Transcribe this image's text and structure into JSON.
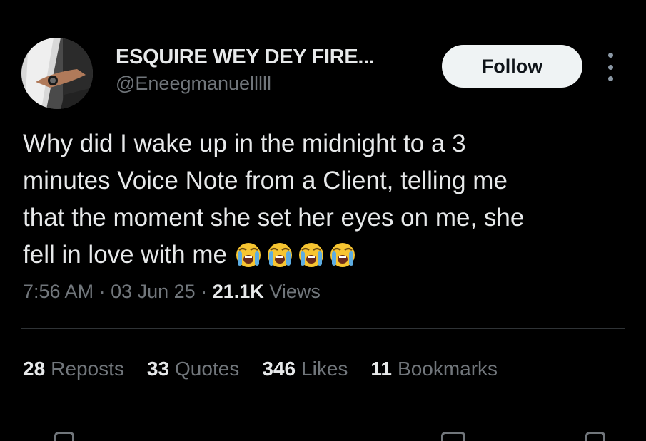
{
  "author": {
    "display_name": "ESQUIRE WEY DEY FIRE...",
    "handle": "@Eneegmanuelllll"
  },
  "follow_button": {
    "label": "Follow"
  },
  "tweet": {
    "text_lines": [
      "Why did I wake up in the midnight to a 3",
      "minutes Voice Note from a Client, telling me",
      "that the moment she set her eyes on me, she",
      "fell in love with me"
    ],
    "emoji": [
      "loudly-crying-face",
      "loudly-crying-face",
      "loudly-crying-face",
      "loudly-crying-face"
    ]
  },
  "meta": {
    "time": "7:56 AM",
    "separator": "·",
    "date": "03 Jun 25",
    "views_count": "21.1K",
    "views_label": "Views"
  },
  "stats": [
    {
      "count": "28",
      "label": "Reposts"
    },
    {
      "count": "33",
      "label": "Quotes"
    },
    {
      "count": "346",
      "label": "Likes"
    },
    {
      "count": "11",
      "label": "Bookmarks"
    }
  ],
  "colors": {
    "background": "#000000",
    "primary_text": "#e7e9ea",
    "secondary_text": "#71767b",
    "divider": "#2f3336",
    "follow_button_bg": "#eff3f4",
    "follow_button_text": "#0f1419"
  }
}
